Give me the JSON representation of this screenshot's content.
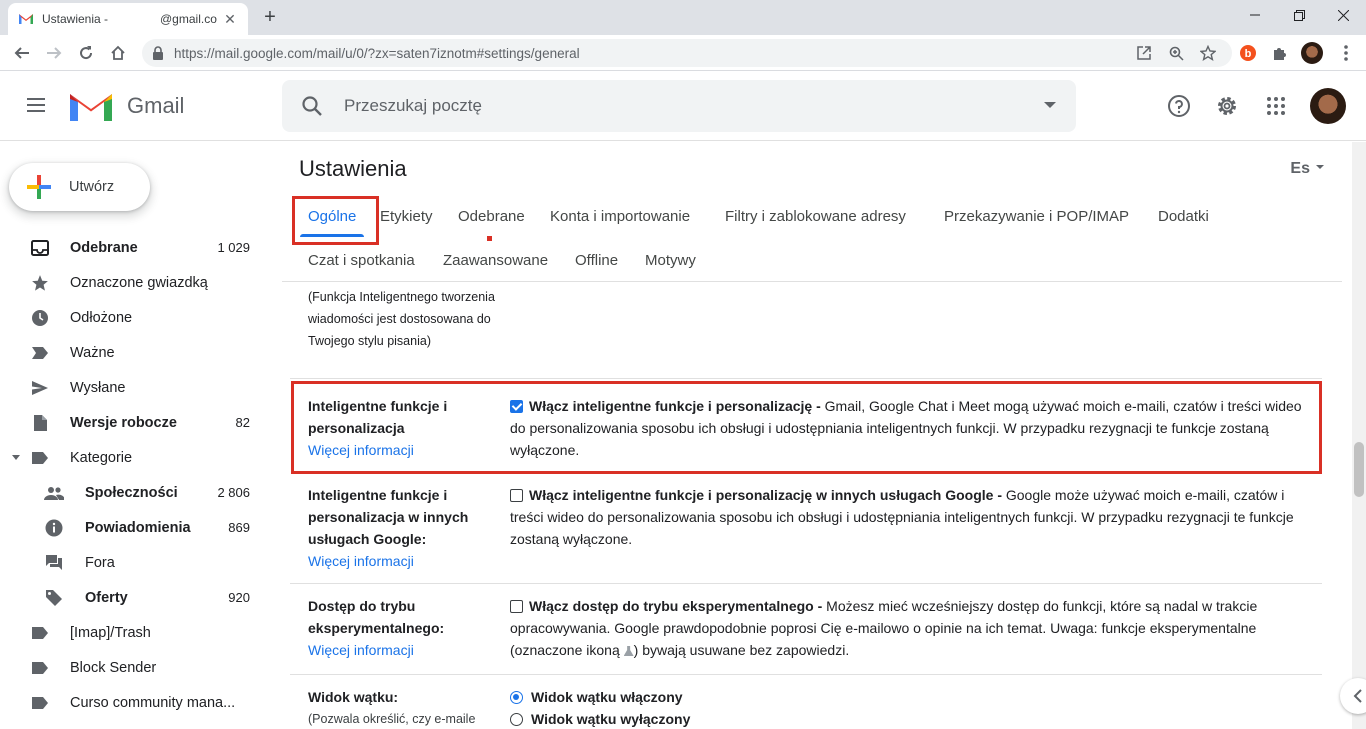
{
  "browser": {
    "tab_title": "Ustawienia -",
    "tab_title_account": "@gmail.co",
    "url": "https://mail.google.com/mail/u/0/?zx=saten7iznotm#settings/general"
  },
  "header": {
    "app_name": "Gmail",
    "search_placeholder": "Przeszukaj pocztę"
  },
  "sidebar": {
    "compose_label": "Utwórz",
    "items": [
      {
        "label": "Odebrane",
        "count": "1 029",
        "icon": "inbox-icon",
        "bold": true
      },
      {
        "label": "Oznaczone gwiazdką",
        "count": "",
        "icon": "star-icon"
      },
      {
        "label": "Odłożone",
        "count": "",
        "icon": "clock-icon"
      },
      {
        "label": "Ważne",
        "count": "",
        "icon": "label-important-icon"
      },
      {
        "label": "Wysłane",
        "count": "",
        "icon": "send-icon"
      },
      {
        "label": "Wersje robocze",
        "count": "82",
        "icon": "draft-icon",
        "bold": true
      },
      {
        "label": "Kategorie",
        "count": "",
        "icon": "label-icon"
      },
      {
        "label": "Społeczności",
        "count": "2 806",
        "icon": "people-icon",
        "bold": true
      },
      {
        "label": "Powiadomienia",
        "count": "869",
        "icon": "info-icon",
        "bold": true
      },
      {
        "label": "Fora",
        "count": "",
        "icon": "forum-icon"
      },
      {
        "label": "Oferty",
        "count": "920",
        "icon": "tag-icon",
        "bold": true
      },
      {
        "label": "[Imap]/Trash",
        "count": "",
        "icon": "label-icon"
      },
      {
        "label": "Block Sender",
        "count": "",
        "icon": "label-icon"
      },
      {
        "label": "Curso community mana...",
        "count": "",
        "icon": "label-icon"
      }
    ]
  },
  "settings": {
    "title": "Ustawienia",
    "language_short": "Es",
    "tabs": [
      "Ogólne",
      "Etykiety",
      "Odebrane",
      "Konta i importowanie",
      "Filtry i zablokowane adresy",
      "Przekazywanie i POP/IMAP",
      "Dodatki",
      "Czat i spotkania",
      "Zaawansowane",
      "Offline",
      "Motywy"
    ],
    "smart_compose_note": "(Funkcja Inteligentnego tworzenia wiadomości jest dostosowana do Twojego stylu pisania)",
    "more_info": "Więcej informacji",
    "smart_features": {
      "label": "Inteligentne funkcje i personalizacja",
      "checked": true,
      "title": "Włącz inteligentne funkcje i personalizację -",
      "description": "Gmail, Google Chat i Meet mogą używać moich e-maili, czatów i treści wideo do personalizowania sposobu ich obsługi i udostępniania inteligentnych funkcji. W przypadku rezygnacji te funkcje zostaną wyłączone."
    },
    "smart_features_other": {
      "label": "Inteligentne funkcje i personalizacja w innych usługach Google:",
      "checked": false,
      "title": "Włącz inteligentne funkcje i personalizację w innych usługach Google -",
      "description": "Google może używać moich e-maili, czatów i treści wideo do personalizowania sposobu ich obsługi i udostępniania inteligentnych funkcji. W przypadku rezygnacji te funkcje zostaną wyłączone."
    },
    "experimental": {
      "label": "Dostęp do trybu eksperymentalnego:",
      "checked": false,
      "title": "Włącz dostęp do trybu eksperymentalnego -",
      "description_a": "Możesz mieć wcześniejszy dostęp do funkcji, które są nadal w trakcie opracowywania. Google prawdopodobnie poprosi Cię e-mailowo o opinie na ich temat. Uwaga: funkcje eksperymentalne (oznaczone ikoną",
      "description_b": ") bywają usuwane bez zapowiedzi."
    },
    "conversation_view": {
      "label": "Widok wątku:",
      "note": "(Pozwala określić, czy e-maile",
      "option_on": "Widok wątku włączony",
      "option_off": "Widok wątku wyłączony",
      "selected": "on"
    }
  }
}
